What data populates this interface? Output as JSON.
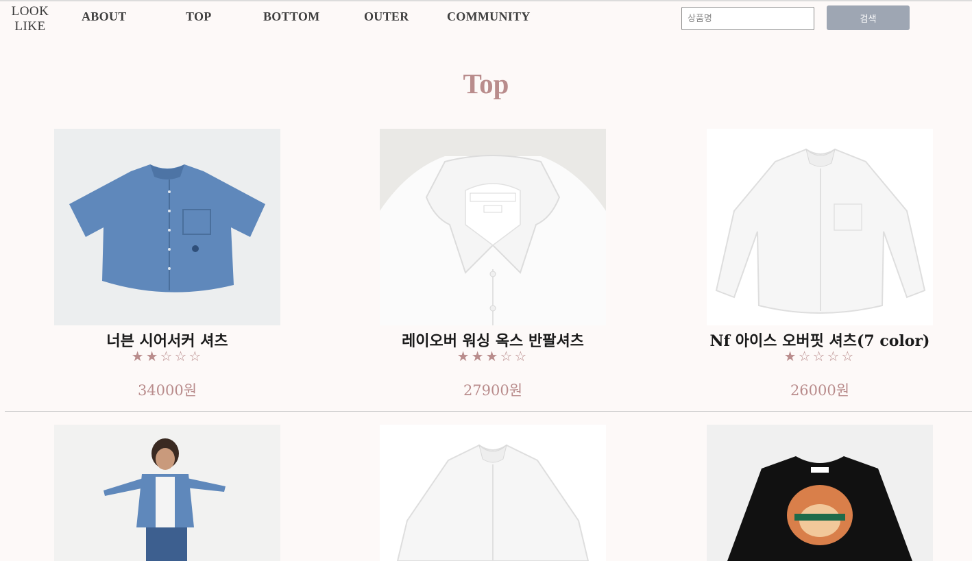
{
  "header": {
    "logo_line1": "LOOK",
    "logo_line2": "LIKE",
    "nav": [
      "ABOUT",
      "TOP",
      "BOTTOM",
      "OUTER",
      "COMMUNITY"
    ],
    "search_placeholder": "상품명",
    "search_button": "검색"
  },
  "page": {
    "title": "Top"
  },
  "products": [
    {
      "name": "너븐 시어서커 셔츠",
      "rating": 2,
      "stars": "★★☆☆☆",
      "price": "34000원",
      "image": "denim-shirt-image"
    },
    {
      "name": "레이오버 워싱 옥스 반팔셔츠",
      "rating": 3,
      "stars": "★★★☆☆",
      "price": "27900원",
      "image": "white-shirt-collar-image"
    },
    {
      "name": "Nf 아이스 오버핏 셔츠(7 color)",
      "rating": 1,
      "stars": "★☆☆☆☆",
      "price": "26000원",
      "image": "white-oversized-shirt-image"
    },
    {
      "name": "",
      "image": "model-denim-shirt-image"
    },
    {
      "name": "",
      "image": "white-shirt-image"
    },
    {
      "name": "",
      "image": "tiger-sweatshirt-image"
    }
  ],
  "colors": {
    "accent": "#b98c8c",
    "search_button": "#9ea6b3",
    "background": "#fdf9f8"
  }
}
